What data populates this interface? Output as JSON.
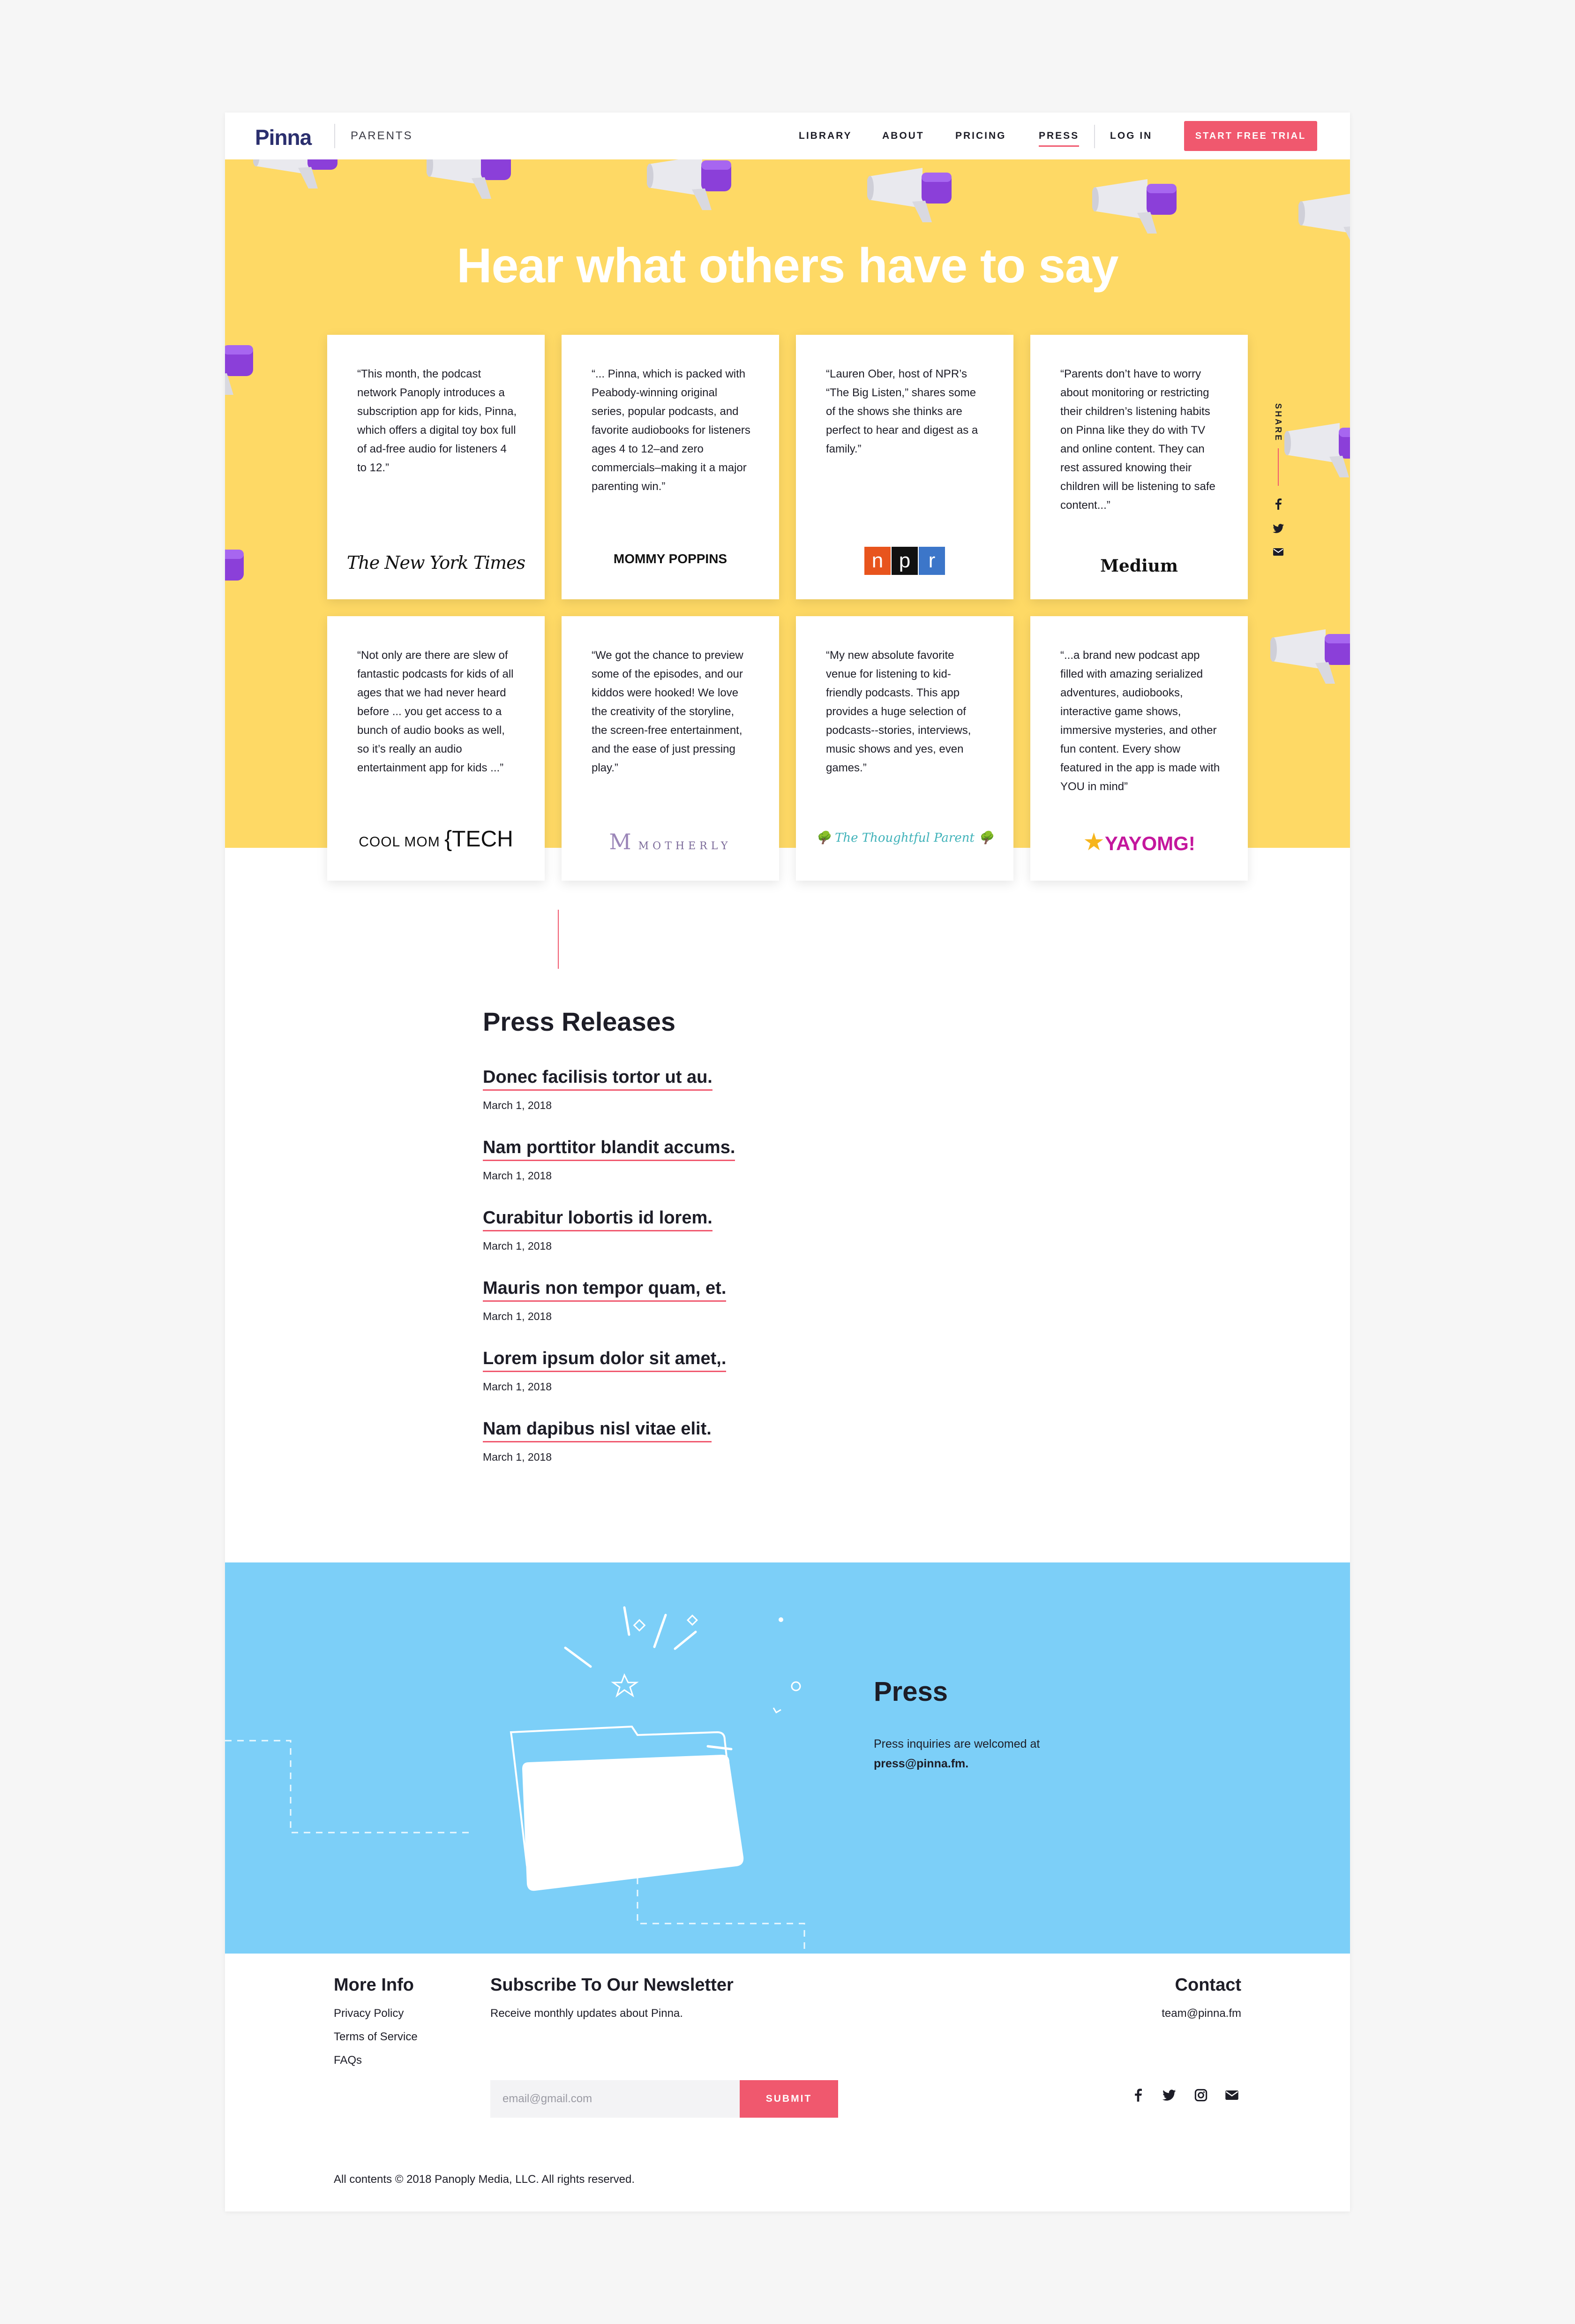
{
  "nav": {
    "logo": "Pinna",
    "section": "PARENTS",
    "links": [
      "LIBRARY",
      "ABOUT",
      "PRICING",
      "PRESS",
      "LOG IN"
    ],
    "active": "PRESS",
    "cta": "START FREE TRIAL"
  },
  "hero": {
    "title": "Hear what others have to say"
  },
  "quotes": [
    {
      "text": "“This month, the podcast network Panoply introduces a subscription app for kids, Pinna, which offers a digital toy box full of ad-free audio for listeners 4 to 12.”",
      "source": "The New York Times"
    },
    {
      "text": "“... Pinna, which is packed with Peabody-winning original series, popular podcasts, and favorite audiobooks for listeners ages 4 to 12–and zero commercials–making it a major parenting win.”",
      "source": "MOMMY POPPINS"
    },
    {
      "text": "“Lauren Ober, host of NPR’s “The Big Listen,” shares some of the shows she thinks are perfect to hear and digest as a family.”",
      "source": "npr"
    },
    {
      "text": "“Parents don’t have to worry about monitoring or restricting their children’s listening habits on Pinna like they do with TV and online content. They can rest assured knowing their children will be listening to safe content...”",
      "source": "Medium"
    },
    {
      "text": "“Not only are there are slew of fantastic podcasts for kids of all ages that we had never heard before ... you get access to a bunch of audio books as well, so it’s really an audio entertainment app for kids ...”",
      "source": "COOL MOM TECH",
      "source_a": "COOL MOM",
      "source_b": "TECH"
    },
    {
      "text": "“We got the chance to preview some of the episodes, and our kiddos were hooked! We love the creativity of the storyline, the screen-free entertainment, and the ease of just pressing play.”",
      "source": "MOTHERLY",
      "source_a": "M"
    },
    {
      "text": "“My new absolute favorite venue for listening to kid-friendly podcasts. This app provides a huge selection of podcasts--stories, interviews, music shows and yes, even games.”",
      "source": "The Thoughtful Parent"
    },
    {
      "text": "“...a brand new podcast app filled with amazing serialized adventures, audiobooks, interactive game shows, immersive mysteries, and other fun content. Every show featured in the app is made with YOU in mind”",
      "source": "YAYOMG!"
    }
  ],
  "share": {
    "label": "SHARE",
    "icons": [
      "facebook-icon",
      "twitter-icon",
      "mail-icon"
    ]
  },
  "press_releases": {
    "heading": "Press Releases",
    "items": [
      {
        "title": "Donec facilisis tortor ut au.",
        "date": "March 1, 2018"
      },
      {
        "title": "Nam porttitor blandit accums.",
        "date": "March 1, 2018"
      },
      {
        "title": "Curabitur lobortis id lorem.",
        "date": "March 1, 2018"
      },
      {
        "title": "Mauris non tempor quam, et.",
        "date": "March 1, 2018"
      },
      {
        "title": "Lorem ipsum dolor sit amet,.",
        "date": "March 1, 2018"
      },
      {
        "title": "Nam dapibus nisl vitae elit.",
        "date": "March 1, 2018"
      }
    ]
  },
  "press": {
    "title": "Press",
    "text": "Press inquiries are welcomed at",
    "email": "press@pinna.fm."
  },
  "footer": {
    "more_info": {
      "heading": "More Info",
      "links": [
        "Privacy Policy",
        "Terms of Service",
        "FAQs"
      ]
    },
    "newsletter": {
      "heading": "Subscribe To Our Newsletter",
      "subtitle": "Receive monthly updates about Pinna.",
      "placeholder": "email@gmail.com",
      "submit": "SUBMIT"
    },
    "contact": {
      "heading": "Contact",
      "email": "team@pinna.fm"
    },
    "social": [
      "facebook-icon",
      "twitter-icon",
      "instagram-icon",
      "mail-icon"
    ],
    "copyright": "All contents © 2018 Panoply Media, LLC. All rights reserved."
  },
  "colors": {
    "brand_yellow": "#fed965",
    "accent_pink": "#f0586e",
    "press_blue": "#7ccff8",
    "megaphone_purple": "#8b3fd9",
    "text_dark": "#1d1d27"
  }
}
